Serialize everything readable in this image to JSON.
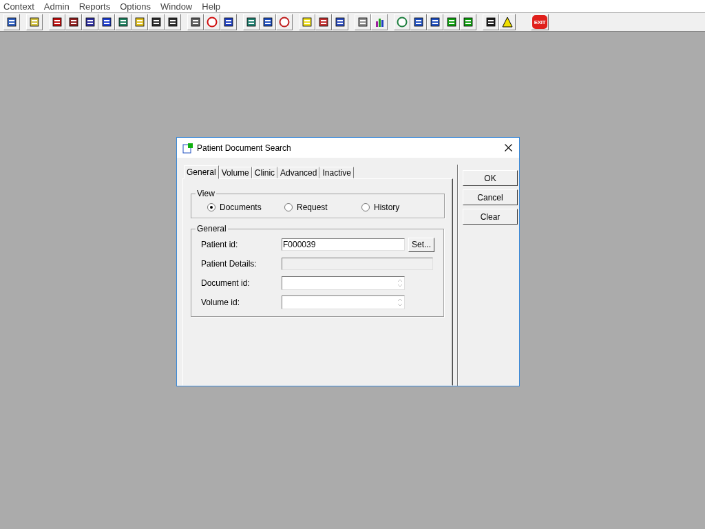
{
  "menu_bar": [
    "Context",
    "Admin",
    "Reports",
    "Options",
    "Window",
    "Help"
  ],
  "toolbar": {
    "exit_label": "EXIT"
  },
  "dialog": {
    "title": "Patient Document Search",
    "tabs": [
      {
        "label": "General",
        "selected": true
      },
      {
        "label": "Volume",
        "selected": false
      },
      {
        "label": "Clinic",
        "selected": false
      },
      {
        "label": "Advanced",
        "selected": false
      },
      {
        "label": "Inactive",
        "selected": false
      }
    ],
    "view_group": {
      "title": "View",
      "options": [
        {
          "label": "Documents",
          "selected": true
        },
        {
          "label": "Request",
          "selected": false
        },
        {
          "label": "History",
          "selected": false
        }
      ]
    },
    "general_group": {
      "title": "General",
      "fields": [
        {
          "kind": "text",
          "label": "Patient id:",
          "value": "F000039",
          "button": "Set..."
        },
        {
          "kind": "readonly",
          "label": "Patient Details:"
        },
        {
          "kind": "spin",
          "label": "Document id:"
        },
        {
          "kind": "spin",
          "label": "Volume id:"
        }
      ]
    },
    "buttons": [
      "OK",
      "Cancel",
      "Clear"
    ]
  }
}
